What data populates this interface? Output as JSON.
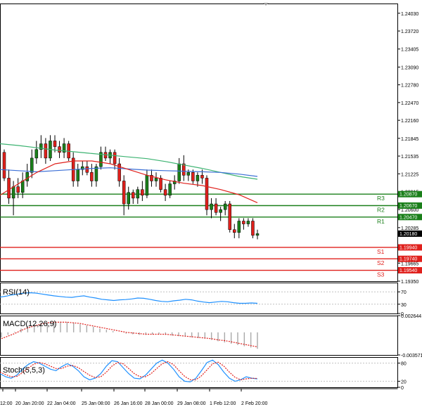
{
  "chart_data": [
    {
      "type": "candlestick",
      "title": "",
      "symbol_info": "",
      "ylim": [
        1.1935,
        1.242
      ],
      "y_ticks": [
        "1.24030",
        "1.23720",
        "1.23405",
        "1.23090",
        "1.22780",
        "1.22470",
        "1.22160",
        "1.21845",
        "1.21535",
        "1.21225",
        "1.20915",
        "1.20600",
        "1.20285",
        "1.19665",
        "1.19350"
      ],
      "x_ticks": [
        "12:00",
        "20 Jan 20:00",
        "22 Jan 04:00",
        "25 Jan 08:00",
        "26 Jan 16:00",
        "28 Jan 00:00",
        "29 Jan 08:00",
        "1 Feb 12:00",
        "2 Feb 20:00"
      ],
      "current_price": "1.20180",
      "candles": [
        {
          "o": 1.216,
          "h": 1.2165,
          "l": 1.211,
          "c": 1.2115
        },
        {
          "o": 1.2115,
          "h": 1.213,
          "l": 1.207,
          "c": 1.208
        },
        {
          "o": 1.208,
          "h": 1.211,
          "l": 1.205,
          "c": 1.21
        },
        {
          "o": 1.21,
          "h": 1.2115,
          "l": 1.208,
          "c": 1.209
        },
        {
          "o": 1.209,
          "h": 1.2125,
          "l": 1.208,
          "c": 1.211
        },
        {
          "o": 1.211,
          "h": 1.214,
          "l": 1.21,
          "c": 1.2125
        },
        {
          "o": 1.2125,
          "h": 1.2165,
          "l": 1.2115,
          "c": 1.215
        },
        {
          "o": 1.215,
          "h": 1.218,
          "l": 1.214,
          "c": 1.2165
        },
        {
          "o": 1.2165,
          "h": 1.219,
          "l": 1.215,
          "c": 1.2175
        },
        {
          "o": 1.2175,
          "h": 1.2185,
          "l": 1.214,
          "c": 1.215
        },
        {
          "o": 1.215,
          "h": 1.219,
          "l": 1.2145,
          "c": 1.218
        },
        {
          "o": 1.218,
          "h": 1.219,
          "l": 1.216,
          "c": 1.217
        },
        {
          "o": 1.217,
          "h": 1.218,
          "l": 1.215,
          "c": 1.216
        },
        {
          "o": 1.216,
          "h": 1.2185,
          "l": 1.215,
          "c": 1.2175
        },
        {
          "o": 1.2175,
          "h": 1.218,
          "l": 1.2145,
          "c": 1.215
        },
        {
          "o": 1.215,
          "h": 1.216,
          "l": 1.21,
          "c": 1.211
        },
        {
          "o": 1.211,
          "h": 1.214,
          "l": 1.21,
          "c": 1.213
        },
        {
          "o": 1.213,
          "h": 1.2145,
          "l": 1.212,
          "c": 1.2135
        },
        {
          "o": 1.2135,
          "h": 1.2145,
          "l": 1.212,
          "c": 1.2125
        },
        {
          "o": 1.2125,
          "h": 1.214,
          "l": 1.21,
          "c": 1.211
        },
        {
          "o": 1.211,
          "h": 1.214,
          "l": 1.21,
          "c": 1.2135
        },
        {
          "o": 1.2135,
          "h": 1.217,
          "l": 1.213,
          "c": 1.216
        },
        {
          "o": 1.216,
          "h": 1.217,
          "l": 1.2145,
          "c": 1.215
        },
        {
          "o": 1.215,
          "h": 1.2165,
          "l": 1.214,
          "c": 1.216
        },
        {
          "o": 1.216,
          "h": 1.2165,
          "l": 1.213,
          "c": 1.214
        },
        {
          "o": 1.214,
          "h": 1.215,
          "l": 1.21,
          "c": 1.211
        },
        {
          "o": 1.211,
          "h": 1.212,
          "l": 1.205,
          "c": 1.207
        },
        {
          "o": 1.207,
          "h": 1.21,
          "l": 1.206,
          "c": 1.209
        },
        {
          "o": 1.209,
          "h": 1.2095,
          "l": 1.207,
          "c": 1.208
        },
        {
          "o": 1.208,
          "h": 1.21,
          "l": 1.207,
          "c": 1.2095
        },
        {
          "o": 1.2095,
          "h": 1.211,
          "l": 1.2075,
          "c": 1.2085
        },
        {
          "o": 1.2085,
          "h": 1.213,
          "l": 1.208,
          "c": 1.212
        },
        {
          "o": 1.212,
          "h": 1.213,
          "l": 1.21,
          "c": 1.211
        },
        {
          "o": 1.211,
          "h": 1.2125,
          "l": 1.21,
          "c": 1.2115
        },
        {
          "o": 1.2115,
          "h": 1.212,
          "l": 1.209,
          "c": 1.2095
        },
        {
          "o": 1.2095,
          "h": 1.2105,
          "l": 1.2075,
          "c": 1.2085
        },
        {
          "o": 1.2085,
          "h": 1.211,
          "l": 1.208,
          "c": 1.2105
        },
        {
          "o": 1.2105,
          "h": 1.212,
          "l": 1.2095,
          "c": 1.211
        },
        {
          "o": 1.211,
          "h": 1.215,
          "l": 1.2105,
          "c": 1.214
        },
        {
          "o": 1.214,
          "h": 1.2155,
          "l": 1.211,
          "c": 1.212
        },
        {
          "o": 1.212,
          "h": 1.213,
          "l": 1.211,
          "c": 1.2125
        },
        {
          "o": 1.2125,
          "h": 1.213,
          "l": 1.2105,
          "c": 1.211
        },
        {
          "o": 1.211,
          "h": 1.2125,
          "l": 1.21,
          "c": 1.212
        },
        {
          "o": 1.212,
          "h": 1.213,
          "l": 1.2105,
          "c": 1.2115
        },
        {
          "o": 1.2115,
          "h": 1.212,
          "l": 1.205,
          "c": 1.206
        },
        {
          "o": 1.206,
          "h": 1.208,
          "l": 1.2045,
          "c": 1.207
        },
        {
          "o": 1.207,
          "h": 1.208,
          "l": 1.205,
          "c": 1.2055
        },
        {
          "o": 1.2055,
          "h": 1.2065,
          "l": 1.204,
          "c": 1.206
        },
        {
          "o": 1.206,
          "h": 1.2075,
          "l": 1.205,
          "c": 1.207
        },
        {
          "o": 1.207,
          "h": 1.2075,
          "l": 1.202,
          "c": 1.2025
        },
        {
          "o": 1.2025,
          "h": 1.2035,
          "l": 1.201,
          "c": 1.202
        },
        {
          "o": 1.202,
          "h": 1.2045,
          "l": 1.201,
          "c": 1.204
        },
        {
          "o": 1.204,
          "h": 1.2045,
          "l": 1.2025,
          "c": 1.2035
        },
        {
          "o": 1.2035,
          "h": 1.2045,
          "l": 1.203,
          "c": 1.204
        },
        {
          "o": 1.204,
          "h": 1.2045,
          "l": 1.201,
          "c": 1.2015
        },
        {
          "o": 1.2015,
          "h": 1.2025,
          "l": 1.2008,
          "c": 1.2018
        }
      ],
      "moving_averages": [
        {
          "color": "#3cb371",
          "values": [
            1.2175,
            1.2172,
            1.2168,
            1.2164,
            1.2161,
            1.2158,
            1.2155,
            1.2152,
            1.2149,
            1.2144,
            1.2138,
            1.2132,
            1.2125,
            1.2118,
            1.2113
          ]
        },
        {
          "color": "#3b6fd6",
          "values": [
            1.213,
            1.2128,
            1.2126,
            1.2128,
            1.213,
            1.2132,
            1.2133,
            1.2131,
            1.2129,
            1.2128,
            1.2127,
            1.2126,
            1.2125,
            1.2122,
            1.2118
          ]
        },
        {
          "color": "#e0201c",
          "values": [
            1.2085,
            1.2105,
            1.2125,
            1.214,
            1.2145,
            1.2145,
            1.214,
            1.213,
            1.212,
            1.2112,
            1.2106,
            1.2102,
            1.2095,
            1.2086,
            1.2072
          ]
        }
      ],
      "levels": [
        {
          "name": "R3",
          "value": "1.20870",
          "price": 1.2087,
          "color": "#1a7f1a"
        },
        {
          "name": "R2",
          "value": "1.20670",
          "price": 1.2067,
          "color": "#1a7f1a"
        },
        {
          "name": "R1",
          "value": "1.20470",
          "price": 1.2047,
          "color": "#1a7f1a"
        },
        {
          "name": "S1",
          "value": "1.19940",
          "price": 1.1994,
          "color": "#e0201c"
        },
        {
          "name": "S2",
          "value": "1.19740",
          "price": 1.1974,
          "color": "#e0201c"
        },
        {
          "name": "S3",
          "value": "1.19540",
          "price": 1.1954,
          "color": "#e0201c"
        }
      ]
    },
    {
      "type": "line",
      "name": "RSI(14)",
      "ylim": [
        0,
        100
      ],
      "y_ticks": [
        "70",
        "30",
        "0"
      ],
      "series": [
        {
          "color": "#1e90ff",
          "values": [
            53,
            56,
            60,
            63,
            66,
            67,
            66,
            63,
            60,
            57,
            55,
            53,
            52,
            55,
            57,
            53,
            50,
            46,
            44,
            42,
            44,
            45,
            47,
            50,
            49,
            46,
            42,
            39,
            38,
            41,
            43,
            46,
            44,
            40,
            37,
            35,
            37,
            39,
            38,
            35,
            33,
            33,
            34,
            33
          ]
        }
      ]
    },
    {
      "type": "bar",
      "name": "MACD(12,26,9)",
      "ylim": [
        -0.003571,
        0.002644
      ],
      "y_ticks": [
        "0.002644",
        "-0.003571"
      ],
      "histogram": [
        -0.0008,
        -0.0004,
        0.0001,
        0.0006,
        0.001,
        0.0013,
        0.0015,
        0.0016,
        0.0017,
        0.0017,
        0.0016,
        0.0015,
        0.0013,
        0.0011,
        0.0009,
        0.0006,
        0.0004,
        0.0002,
        0.0,
        -0.0002,
        -0.0003,
        -0.0004,
        -0.0004,
        -0.0003,
        -0.0003,
        -0.0004,
        -0.0005,
        -0.0006,
        -0.0007,
        -0.0008,
        -0.0009,
        -0.001,
        -0.0012,
        -0.0014,
        -0.0016,
        -0.0018,
        -0.002,
        -0.0022,
        -0.0024,
        -0.0026
      ],
      "signal": [
        -0.001,
        -0.0006,
        -0.0002,
        0.0003,
        0.0007,
        0.001,
        0.0013,
        0.0015,
        0.0016,
        0.0016,
        0.0016,
        0.0015,
        0.0014,
        0.0012,
        0.001,
        0.0008,
        0.0006,
        0.0004,
        0.0002,
        0.0,
        -0.0001,
        -0.0002,
        -0.0003,
        -0.0003,
        -0.0003,
        -0.0003,
        -0.0004,
        -0.0005,
        -0.0006,
        -0.0007,
        -0.0008,
        -0.0009,
        -0.001,
        -0.0012,
        -0.0013,
        -0.0015,
        -0.0017,
        -0.0019,
        -0.0021,
        -0.0023
      ]
    },
    {
      "type": "line",
      "name": "Stoch(5,5,3)",
      "ylim": [
        0,
        100
      ],
      "y_ticks": [
        "80",
        "20",
        "0"
      ],
      "series": [
        {
          "color": "#1e90ff",
          "values": [
            45,
            35,
            30,
            40,
            60,
            75,
            85,
            80,
            70,
            60,
            55,
            68,
            78,
            70,
            55,
            35,
            25,
            30,
            45,
            70,
            88,
            85,
            65,
            45,
            30,
            28,
            40,
            60,
            80,
            90,
            80,
            60,
            35,
            20,
            18,
            30,
            55,
            82,
            90,
            75,
            50,
            30,
            20,
            25,
            35,
            30,
            28
          ]
        },
        {
          "color": "#e0201c",
          "values": [
            50,
            42,
            35,
            36,
            48,
            62,
            76,
            82,
            78,
            70,
            62,
            62,
            70,
            72,
            65,
            52,
            40,
            32,
            35,
            50,
            70,
            82,
            78,
            62,
            45,
            35,
            35,
            45,
            62,
            78,
            85,
            75,
            55,
            36,
            25,
            25,
            38,
            58,
            78,
            83,
            70,
            50,
            33,
            25,
            28,
            30,
            29
          ]
        }
      ]
    }
  ]
}
